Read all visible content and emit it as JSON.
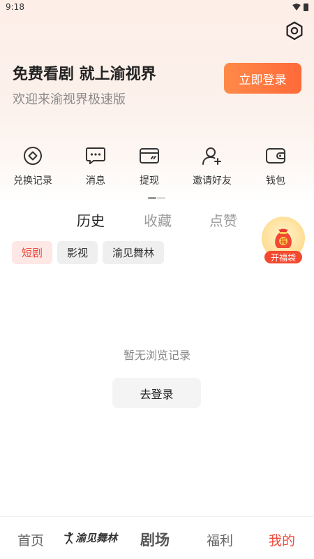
{
  "status_bar": {
    "time": "9:18"
  },
  "promo": {
    "title": "免费看剧 就上渝视界",
    "subtitle": "欢迎来渝视界极速版",
    "login_button": "立即登录"
  },
  "quick_actions": [
    {
      "label": "兑换记录",
      "icon": "redeem-icon"
    },
    {
      "label": "消息",
      "icon": "message-icon"
    },
    {
      "label": "提现",
      "icon": "card-icon"
    },
    {
      "label": "邀请好友",
      "icon": "invite-user-icon"
    },
    {
      "label": "钱包",
      "icon": "wallet-icon"
    }
  ],
  "tabs": [
    {
      "label": "历史",
      "active": true
    },
    {
      "label": "收藏",
      "active": false
    },
    {
      "label": "点赞",
      "active": false
    }
  ],
  "chips": [
    {
      "label": "短剧",
      "active": true
    },
    {
      "label": "影视",
      "active": false
    },
    {
      "label": "渝见舞林",
      "active": false
    }
  ],
  "lucky_bag": {
    "label": "开福袋",
    "bag_char": "福"
  },
  "empty": {
    "text": "暂无浏览记录",
    "button": "去登录"
  },
  "bottom_nav": {
    "home": "首页",
    "dance": "渝见舞林",
    "drama": "剧场",
    "welfare": "福利",
    "mine": "我的",
    "active": "mine"
  },
  "colors": {
    "accent": "#ff6a3a",
    "active_red": "#f0483a"
  }
}
